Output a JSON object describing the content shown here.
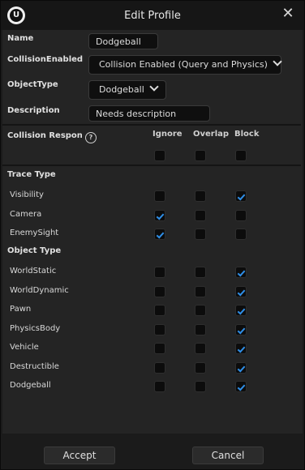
{
  "window": {
    "title": "Edit Profile",
    "logo_text": "U"
  },
  "fields": {
    "name_label": "Name",
    "name_value": "Dodgeball",
    "collision_label": "CollisionEnabled",
    "collision_value": "Collision Enabled (Query and Physics)",
    "objecttype_label": "ObjectType",
    "objecttype_value": "Dodgeball",
    "description_label": "Description",
    "description_value": "Needs description"
  },
  "responses": {
    "label": "Collision Respons",
    "help_glyph": "?",
    "columns": [
      "Ignore",
      "Overlap",
      "Block"
    ],
    "all_row": [
      false,
      false,
      false
    ]
  },
  "trace_type": {
    "title": "Trace Type",
    "rows": [
      {
        "label": "Visibility",
        "checks": [
          false,
          false,
          true
        ]
      },
      {
        "label": "Camera",
        "checks": [
          true,
          false,
          false
        ]
      },
      {
        "label": "EnemySight",
        "checks": [
          true,
          false,
          false
        ]
      }
    ]
  },
  "object_type": {
    "title": "Object Type",
    "rows": [
      {
        "label": "WorldStatic",
        "checks": [
          false,
          false,
          true
        ]
      },
      {
        "label": "WorldDynamic",
        "checks": [
          false,
          false,
          true
        ]
      },
      {
        "label": "Pawn",
        "checks": [
          false,
          false,
          true
        ]
      },
      {
        "label": "PhysicsBody",
        "checks": [
          false,
          false,
          true
        ]
      },
      {
        "label": "Vehicle",
        "checks": [
          false,
          false,
          true
        ]
      },
      {
        "label": "Destructible",
        "checks": [
          false,
          false,
          true
        ]
      },
      {
        "label": "Dodgeball",
        "checks": [
          false,
          false,
          true
        ]
      }
    ]
  },
  "buttons": {
    "accept": "Accept",
    "cancel": "Cancel"
  },
  "colors": {
    "check": "#2f8ee6",
    "panel": "#242424"
  }
}
